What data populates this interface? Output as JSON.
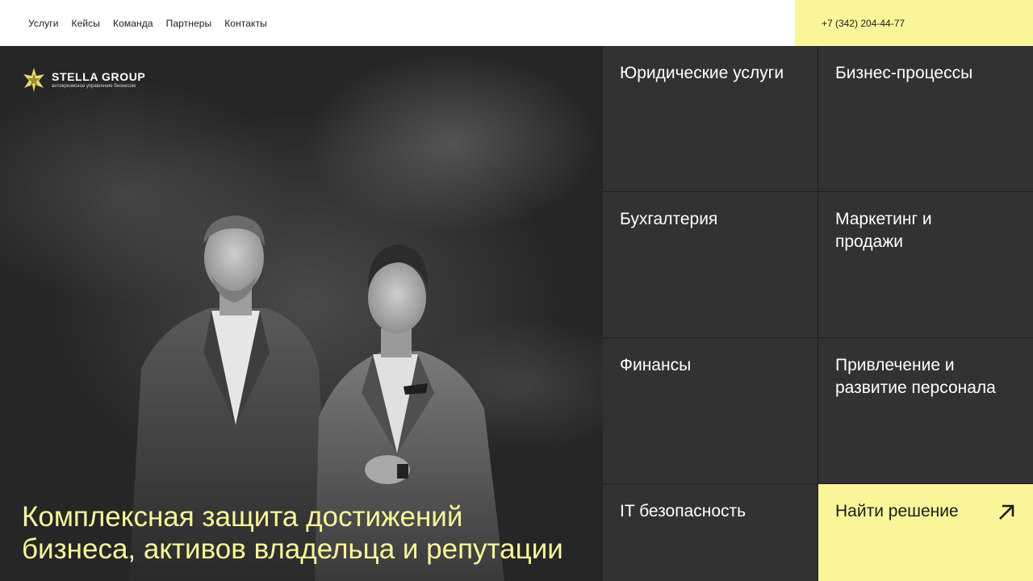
{
  "nav": {
    "items": [
      "Услуги",
      "Кейсы",
      "Команда",
      "Партнеры",
      "Контакты"
    ]
  },
  "contact": {
    "phone": "+7 (342) 204-44-77"
  },
  "brand": {
    "name": "STELLA GROUP",
    "tagline": "антикризисное управление бизнесом",
    "icon": "star-logo-icon"
  },
  "hero": {
    "headline_line1": "Комплексная защита достижений",
    "headline_line2": "бизнеса, активов владельца и репутации"
  },
  "services": [
    "Юридические услуги",
    "Бизнес-процессы",
    "Бухгалтерия",
    "Маркетинг и продажи",
    "Финансы",
    "Привлечение и развитие персонала",
    "IT безопасность"
  ],
  "cta": {
    "label": "Найти решение",
    "icon": "arrow-up-right-icon"
  },
  "colors": {
    "accent": "#fbf59a",
    "tile": "#333132",
    "text_dark": "#1c1c1c"
  }
}
